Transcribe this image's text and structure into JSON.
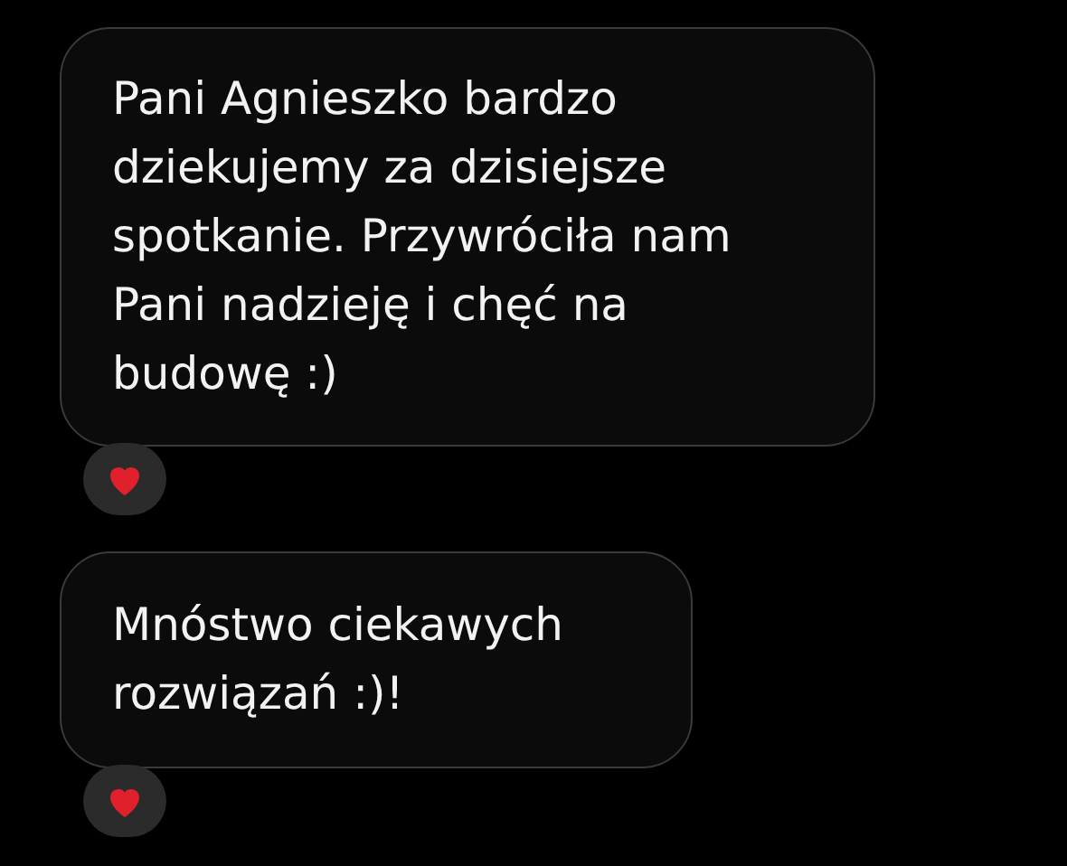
{
  "messages": [
    {
      "text": "Pani Agnieszko bardzo dziekujemy za dzisiejsze spotkanie. Przywróciła nam Pani nadzieję i chęć na budowę :)",
      "reacted": true
    },
    {
      "text": "Mnóstwo ciekawych rozwiązań :)!",
      "reacted": true
    }
  ]
}
